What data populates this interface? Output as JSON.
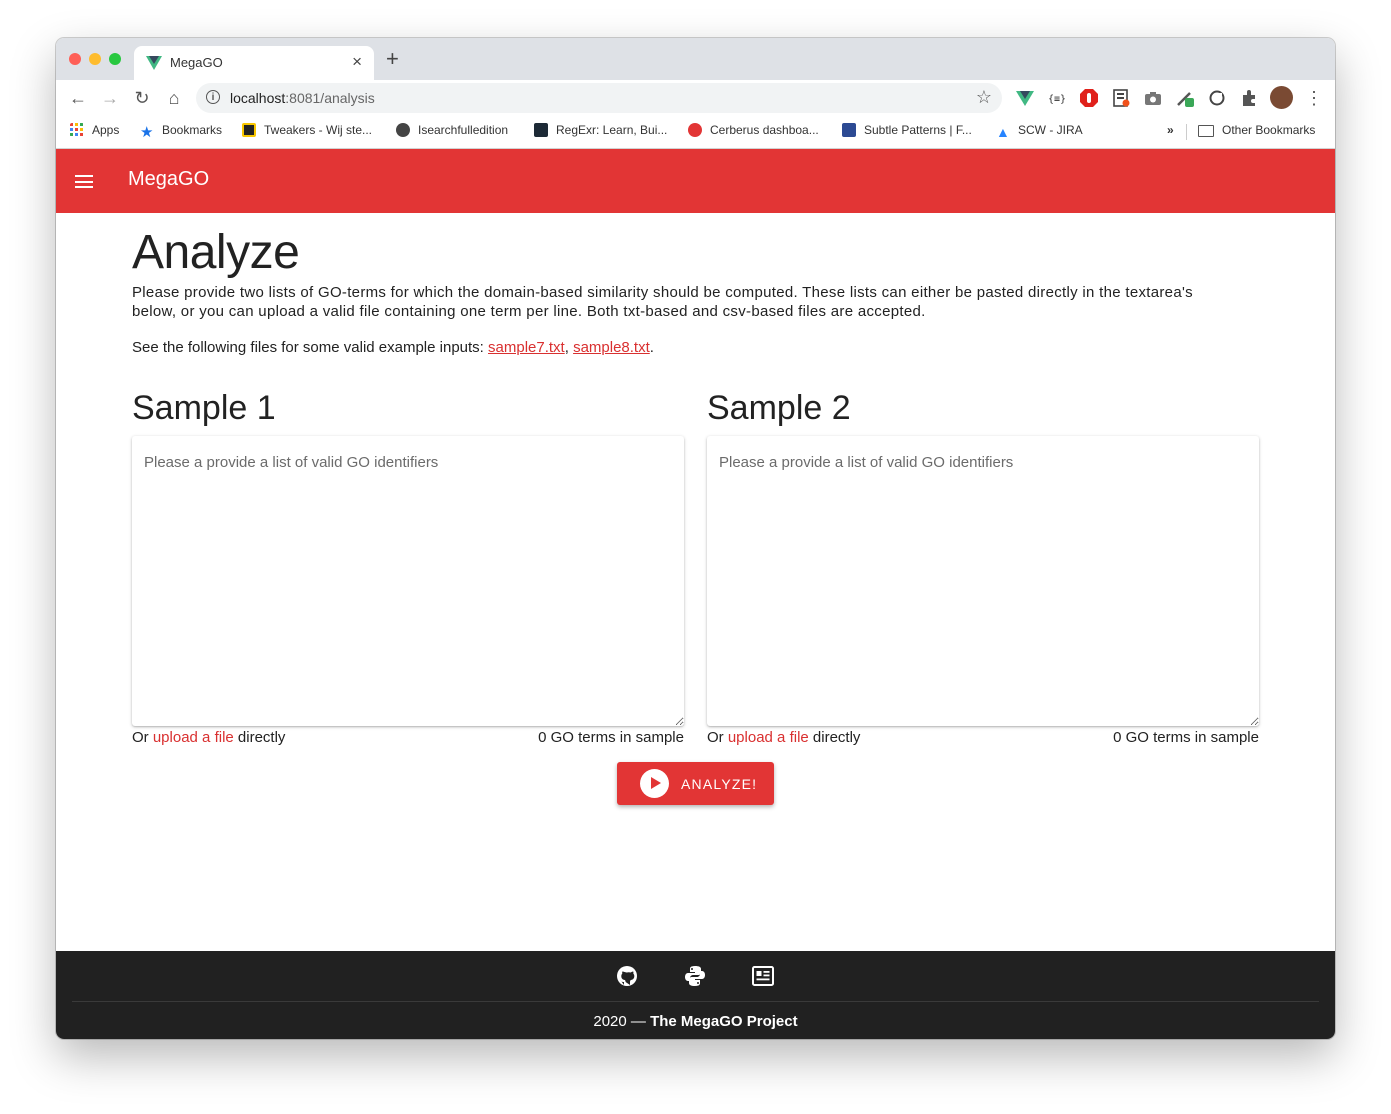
{
  "browser": {
    "tab_title": "MegaGO",
    "url_host": "localhost",
    "url_path": ":8081/analysis",
    "bookmarks": [
      {
        "label": "Apps",
        "icon": "apps-grid-icon"
      },
      {
        "label": "Bookmarks",
        "icon": "star-icon"
      },
      {
        "label": "Tweakers - Wij ste...",
        "icon": "tweakers-icon"
      },
      {
        "label": "Isearchfulledition",
        "icon": "globe-icon"
      },
      {
        "label": "RegExr: Learn, Bui...",
        "icon": "regexr-icon"
      },
      {
        "label": "Cerberus dashboa...",
        "icon": "cerberus-icon"
      },
      {
        "label": "Subtle Patterns | F...",
        "icon": "subtle-patterns-icon"
      },
      {
        "label": "SCW - JIRA",
        "icon": "jira-icon"
      }
    ],
    "overflow_label": "»",
    "other_bookmarks": "Other Bookmarks"
  },
  "appbar": {
    "title": "MegaGO"
  },
  "main": {
    "title": "Analyze",
    "description": "Please provide two lists of GO-terms for which the domain-based similarity should be computed. These lists can either be pasted directly in the textarea's below, or you can upload a valid file containing one term per line. Both txt-based and csv-based files are accepted.",
    "examples_prefix": "See the following files for some valid example inputs: ",
    "example_files": [
      "sample7.txt",
      "sample8.txt"
    ],
    "examples_sep": ", ",
    "examples_suffix": ".",
    "samples": [
      {
        "heading": "Sample 1",
        "placeholder": "Please a provide a list of valid GO identifiers",
        "upload_prefix": "Or ",
        "upload_link": "upload a file",
        "upload_suffix": " directly",
        "count_text": "0 GO terms in sample"
      },
      {
        "heading": "Sample 2",
        "placeholder": "Please a provide a list of valid GO identifiers",
        "upload_prefix": "Or ",
        "upload_link": "upload a file",
        "upload_suffix": " directly",
        "count_text": "0 GO terms in sample"
      }
    ],
    "analyze_label": "ANALYZE!"
  },
  "footer": {
    "icons": [
      "github-icon",
      "python-icon",
      "article-icon"
    ],
    "year": "2020 — ",
    "project": "The MegaGO Project"
  },
  "colors": {
    "primary": "#e23535",
    "footer": "#212121",
    "link": "#d93030"
  }
}
